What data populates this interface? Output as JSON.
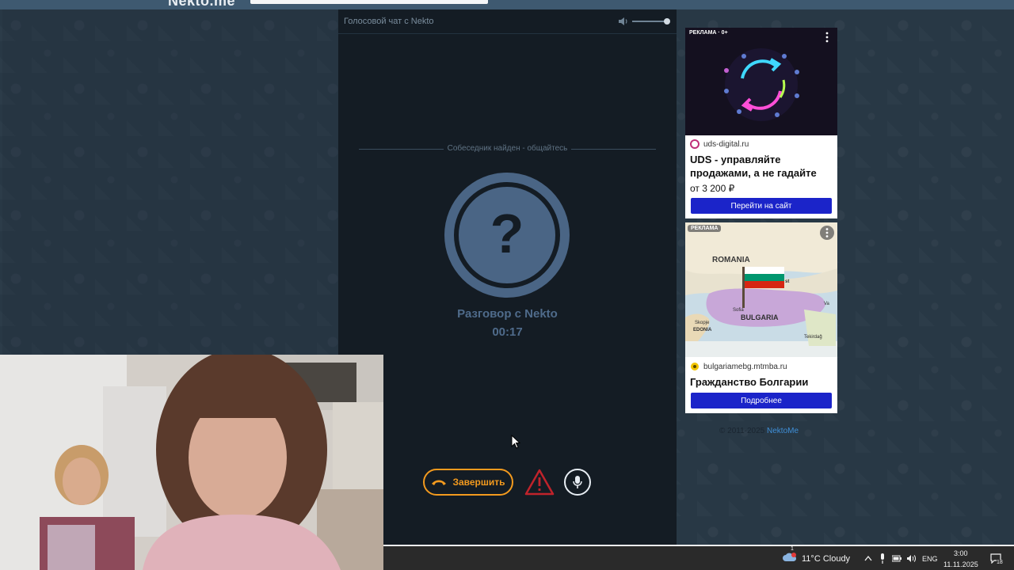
{
  "topbar": {
    "logo": "Nekto.me"
  },
  "chat": {
    "title": "Голосовой чат с Nekto",
    "status": "Собеседник найден - общайтесь",
    "avatar_symbol": "?",
    "partner": "Разговор с Nekto",
    "timer": "00:17",
    "end_label": "Завершить"
  },
  "ads": [
    {
      "badge": "РЕКЛАМА · 0+",
      "domain": "uds-digital.ru",
      "headline": "UDS - управляйте продажами, а не гадайте",
      "price": "от 3 200 ₽",
      "button": "Перейти на сайт"
    },
    {
      "badge": "РЕКЛАМА",
      "domain": "bulgariamebg.mtmba.ru",
      "headline": "Гражданство Болгарии",
      "button": "Подробнее",
      "map_labels": [
        "ROMANIA",
        "BULGARIA",
        "Sofia",
        "Skopje",
        "EDONIA",
        "Tekirdağ",
        "Va",
        "st"
      ]
    }
  ],
  "footer": {
    "copyright": "© 2011-2025",
    "link": "NektoMe"
  },
  "taskbar": {
    "weather": "11°C  Cloudy",
    "weather_badge": "1",
    "language": "ENG",
    "time": "3:00",
    "date": "11.11.2025",
    "notifications": "18"
  },
  "colors": {
    "accent_orange": "#f39a1e",
    "avatar_blue": "#4a6585",
    "ad_button": "#1b24c9",
    "link": "#3f8fd8"
  }
}
